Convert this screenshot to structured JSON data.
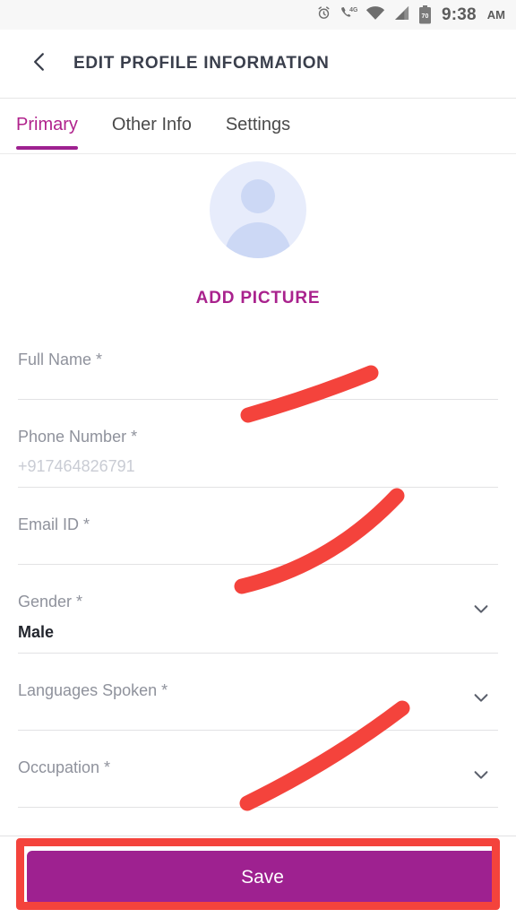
{
  "statusbar": {
    "icons": [
      "alarm-icon",
      "call-4g-icon",
      "wifi-icon",
      "signal-icon",
      "battery-icon"
    ],
    "battery_level": "70",
    "time": "9:38",
    "ampm": "AM"
  },
  "header": {
    "back_icon": "chevron-left-icon",
    "title": "EDIT PROFILE INFORMATION"
  },
  "tabs": [
    {
      "label": "Primary",
      "active": true
    },
    {
      "label": "Other Info",
      "active": false
    },
    {
      "label": "Settings",
      "active": false
    }
  ],
  "profile": {
    "avatar_icon": "person-avatar-icon",
    "add_picture_label": "ADD PICTURE"
  },
  "form": {
    "fields": [
      {
        "label": "Full Name *",
        "value": "",
        "filled": false,
        "dropdown": false
      },
      {
        "label": "Phone Number *",
        "value": "+917464826791",
        "filled": false,
        "dropdown": false
      },
      {
        "label": "Email ID *",
        "value": "",
        "filled": false,
        "dropdown": false
      },
      {
        "label": "Gender *",
        "value": "Male",
        "filled": true,
        "dropdown": true
      },
      {
        "label": "Languages Spoken *",
        "value": "",
        "filled": false,
        "dropdown": true
      },
      {
        "label": "Occupation *",
        "value": "",
        "filled": false,
        "dropdown": true
      }
    ]
  },
  "footer": {
    "save_label": "Save"
  },
  "colors": {
    "accent_purple": "#9e2190",
    "tab_active": "#b0228c",
    "annotation_red": "#f4433c",
    "label_gray": "#8f929c",
    "value_gray": "#c9ccd4",
    "title_dark": "#3a3f4c",
    "avatar_bg": "#e7ecfb",
    "avatar_fg": "#ccd8f5",
    "statusbar_bg": "#f7f7f7"
  },
  "annotations": {
    "kind": "handwritten-red-marks",
    "strokes": [
      {
        "name": "stroke-over-full-name-line"
      },
      {
        "name": "stroke-over-email-line"
      },
      {
        "name": "stroke-over-languages-line"
      }
    ],
    "box": {
      "name": "highlight-box-around-save-button"
    }
  }
}
